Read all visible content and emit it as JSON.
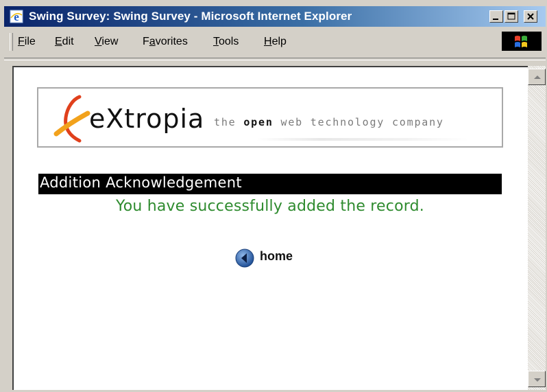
{
  "window": {
    "title": "Swing Survey: Swing Survey - Microsoft Internet Explorer"
  },
  "menu": {
    "file": {
      "first": "F",
      "rest": "ile"
    },
    "edit": {
      "first": "E",
      "rest": "dit"
    },
    "view": {
      "first": "V",
      "rest": "iew"
    },
    "favorites": {
      "pre": "F",
      "ul": "a",
      "rest": "vorites"
    },
    "tools": {
      "first": "T",
      "rest": "ools"
    },
    "help": {
      "first": "H",
      "rest": "elp"
    }
  },
  "banner": {
    "brand": "eXtropia",
    "tagline_pre": "the ",
    "tagline_open": "open",
    "tagline_post": " web technology company"
  },
  "page": {
    "heading": "Addition Acknowledgement",
    "message": "You have successfully added the record.",
    "home_label": "home"
  },
  "colors": {
    "title_bar": "#0a246a",
    "success_text": "#2e8b2e",
    "heading_bg": "#000000",
    "home_icon": "#1f5fa8"
  }
}
